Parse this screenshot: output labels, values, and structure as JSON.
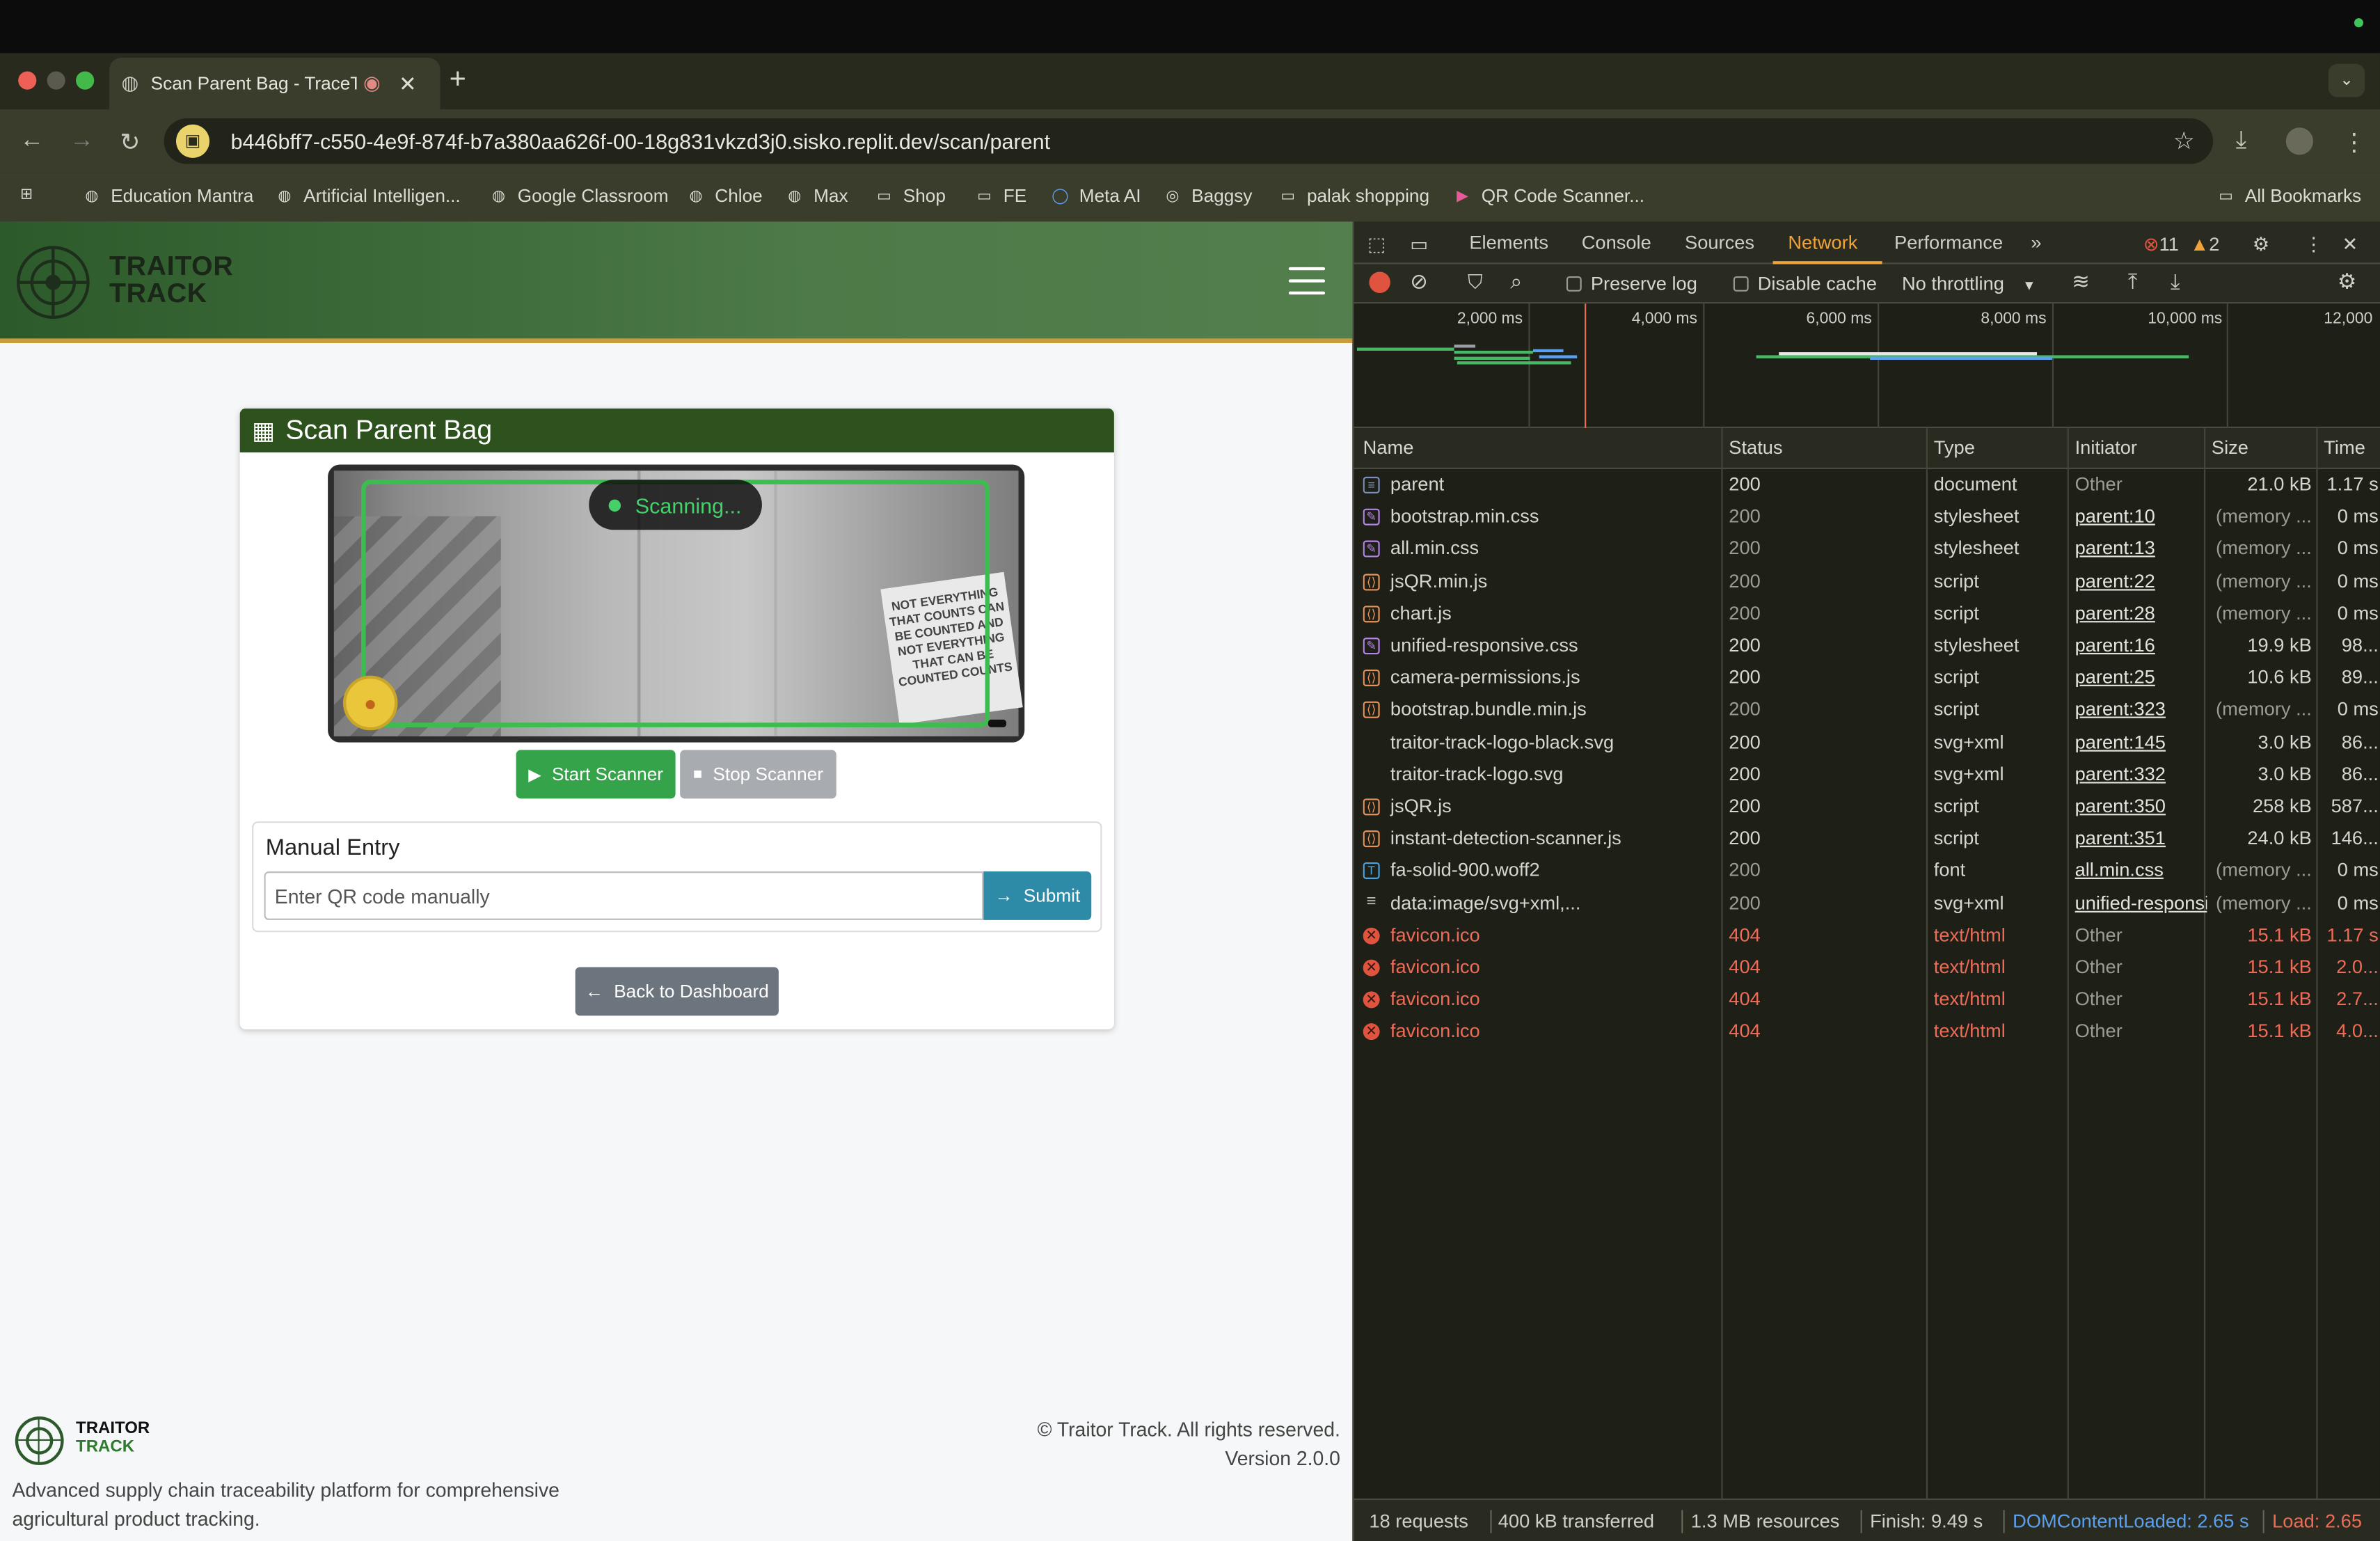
{
  "browser": {
    "tab_title": "Scan Parent Bag - TraceTr",
    "url": "b446bff7-c550-4e9f-874f-b7a380aa626f-00-18g831vkzd3j0.sisko.replit.dev/scan/parent",
    "bookmarks": [
      "Education Mantra",
      "Artificial Intelligen...",
      "Google Classroom",
      "Chloe",
      "Max",
      "Shop",
      "FE",
      "Meta AI",
      "Baggsy",
      "palak shopping",
      "QR Code Scanner..."
    ],
    "all_bookmarks": "All Bookmarks"
  },
  "app": {
    "brand_line1": "TRAITOR",
    "brand_line2": "TRACK",
    "card_title": "Scan Parent Bag",
    "scanning_label": "Scanning...",
    "poster_text": "NOT EVERYTHING THAT COUNTS CAN BE COUNTED AND NOT EVERYTHING THAT CAN BE COUNTED COUNTS",
    "start_scanner": "Start Scanner",
    "stop_scanner": "Stop Scanner",
    "manual_title": "Manual Entry",
    "manual_placeholder": "Enter QR code manually",
    "submit": "Submit",
    "back": "Back to Dashboard",
    "footer_desc": "Advanced supply chain traceability platform for comprehensive agricultural product tracking.",
    "footer_copyright": "© Traitor Track. All rights reserved.",
    "footer_version": "Version 2.0.0"
  },
  "devtools": {
    "tabs": [
      "Elements",
      "Console",
      "Sources",
      "Network",
      "Performance"
    ],
    "active_tab": "Network",
    "errors": "11",
    "warnings": "2",
    "preserve_log": "Preserve log",
    "disable_cache": "Disable cache",
    "throttling": "No throttling",
    "timeline_labels": [
      "2,000 ms",
      "4,000 ms",
      "6,000 ms",
      "8,000 ms",
      "10,000 ms",
      "12,000"
    ],
    "columns": [
      "Name",
      "Status",
      "Type",
      "Initiator",
      "Size",
      "Time"
    ],
    "rows": [
      {
        "name": "parent",
        "icon": "doc",
        "status": "200",
        "type": "document",
        "initiator": "Other",
        "size": "21.0 kB",
        "time": "1.17 s",
        "status_style": "normal",
        "init_style": "muted"
      },
      {
        "name": "bootstrap.min.css",
        "icon": "css",
        "status": "200",
        "type": "stylesheet",
        "initiator": "parent:10",
        "size": "(memory ...",
        "time": "0 ms",
        "status_style": "muted",
        "init_style": "link"
      },
      {
        "name": "all.min.css",
        "icon": "css",
        "status": "200",
        "type": "stylesheet",
        "initiator": "parent:13",
        "size": "(memory ...",
        "time": "0 ms",
        "status_style": "muted",
        "init_style": "link"
      },
      {
        "name": "jsQR.min.js",
        "icon": "js",
        "status": "200",
        "type": "script",
        "initiator": "parent:22",
        "size": "(memory ...",
        "time": "0 ms",
        "status_style": "muted",
        "init_style": "link"
      },
      {
        "name": "chart.js",
        "icon": "js",
        "status": "200",
        "type": "script",
        "initiator": "parent:28",
        "size": "(memory ...",
        "time": "0 ms",
        "status_style": "muted",
        "init_style": "link"
      },
      {
        "name": "unified-responsive.css",
        "icon": "css",
        "status": "200",
        "type": "stylesheet",
        "initiator": "parent:16",
        "size": "19.9 kB",
        "time": "98...",
        "status_style": "normal",
        "init_style": "link"
      },
      {
        "name": "camera-permissions.js",
        "icon": "js",
        "status": "200",
        "type": "script",
        "initiator": "parent:25",
        "size": "10.6 kB",
        "time": "89...",
        "status_style": "normal",
        "init_style": "link"
      },
      {
        "name": "bootstrap.bundle.min.js",
        "icon": "js",
        "status": "200",
        "type": "script",
        "initiator": "parent:323",
        "size": "(memory ...",
        "time": "0 ms",
        "status_style": "muted",
        "init_style": "link"
      },
      {
        "name": "traitor-track-logo-black.svg",
        "icon": "none",
        "status": "200",
        "type": "svg+xml",
        "initiator": "parent:145",
        "size": "3.0 kB",
        "time": "86...",
        "status_style": "normal",
        "init_style": "link"
      },
      {
        "name": "traitor-track-logo.svg",
        "icon": "none",
        "status": "200",
        "type": "svg+xml",
        "initiator": "parent:332",
        "size": "3.0 kB",
        "time": "86...",
        "status_style": "normal",
        "init_style": "link"
      },
      {
        "name": "jsQR.js",
        "icon": "js",
        "status": "200",
        "type": "script",
        "initiator": "parent:350",
        "size": "258 kB",
        "time": "587...",
        "status_style": "normal",
        "init_style": "link"
      },
      {
        "name": "instant-detection-scanner.js",
        "icon": "js",
        "status": "200",
        "type": "script",
        "initiator": "parent:351",
        "size": "24.0 kB",
        "time": "146...",
        "status_style": "normal",
        "init_style": "link"
      },
      {
        "name": "fa-solid-900.woff2",
        "icon": "font",
        "status": "200",
        "type": "font",
        "initiator": "all.min.css",
        "size": "(memory ...",
        "time": "0 ms",
        "status_style": "muted",
        "init_style": "link"
      },
      {
        "name": "data:image/svg+xml,...",
        "icon": "data",
        "status": "200",
        "type": "svg+xml",
        "initiator": "unified-responsi",
        "size": "(memory ...",
        "time": "0 ms",
        "status_style": "muted",
        "init_style": "link"
      },
      {
        "name": "favicon.ico",
        "icon": "err",
        "status": "404",
        "type": "text/html",
        "initiator": "Other",
        "size": "15.1 kB",
        "time": "1.17 s",
        "status_style": "err",
        "init_style": "muted"
      },
      {
        "name": "favicon.ico",
        "icon": "err",
        "status": "404",
        "type": "text/html",
        "initiator": "Other",
        "size": "15.1 kB",
        "time": "2.0...",
        "status_style": "err",
        "init_style": "muted"
      },
      {
        "name": "favicon.ico",
        "icon": "err",
        "status": "404",
        "type": "text/html",
        "initiator": "Other",
        "size": "15.1 kB",
        "time": "2.7...",
        "status_style": "err",
        "init_style": "muted"
      },
      {
        "name": "favicon.ico",
        "icon": "err",
        "status": "404",
        "type": "text/html",
        "initiator": "Other",
        "size": "15.1 kB",
        "time": "4.0...",
        "status_style": "err",
        "init_style": "muted"
      }
    ],
    "summary": {
      "requests": "18 requests",
      "transferred": "400 kB transferred",
      "resources": "1.3 MB resources",
      "finish": "Finish: 9.49 s",
      "dcl": "DOMContentLoaded: 2.65 s",
      "load": "Load: 2.65"
    }
  },
  "colors": {
    "accent_green": "#2e521e",
    "start_green": "#34a34a",
    "submit_teal": "#2e8ba8",
    "devtools_active": "#f0a33a",
    "error_red": "#ee6b58",
    "dcl_blue": "#5aa0f0",
    "load_red": "#ee6b58"
  }
}
